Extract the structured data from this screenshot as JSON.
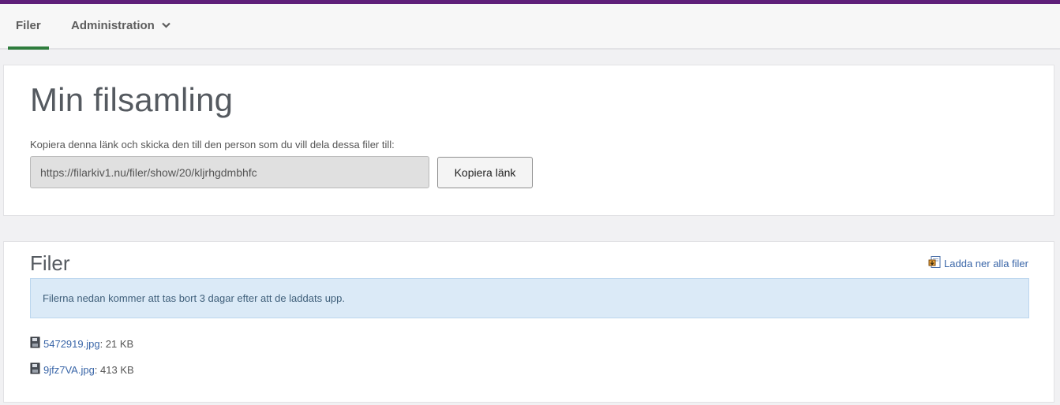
{
  "nav": {
    "items": [
      {
        "label": "Filer",
        "active": true
      },
      {
        "label": "Administration",
        "has_dropdown": true
      }
    ]
  },
  "collection": {
    "title": "Min filsamling",
    "description": "Kopiera denna länk och skicka den till den person som du vill dela dessa filer till:",
    "link_value": "https://filarkiv1.nu/filer/show/20/kljrhgdmbhfc",
    "copy_button": "Kopiera länk"
  },
  "files": {
    "title": "Filer",
    "download_all": "Ladda ner alla filer",
    "notice": "Filerna nedan kommer att tas bort 3 dagar efter att de laddats upp.",
    "items": [
      {
        "name": "5472919.jpg",
        "size": ": 21 KB"
      },
      {
        "name": "9jfz7VA.jpg",
        "size": ": 413 KB"
      }
    ]
  },
  "colors": {
    "topbar": "#5f1f7a",
    "active_tab": "#2f7d3d",
    "link": "#3a66a8",
    "notice_bg": "#dbeaf7"
  },
  "icons": {
    "download_all": "download-archive-icon",
    "file": "file-icon",
    "dropdown": "chevron-down-icon"
  }
}
